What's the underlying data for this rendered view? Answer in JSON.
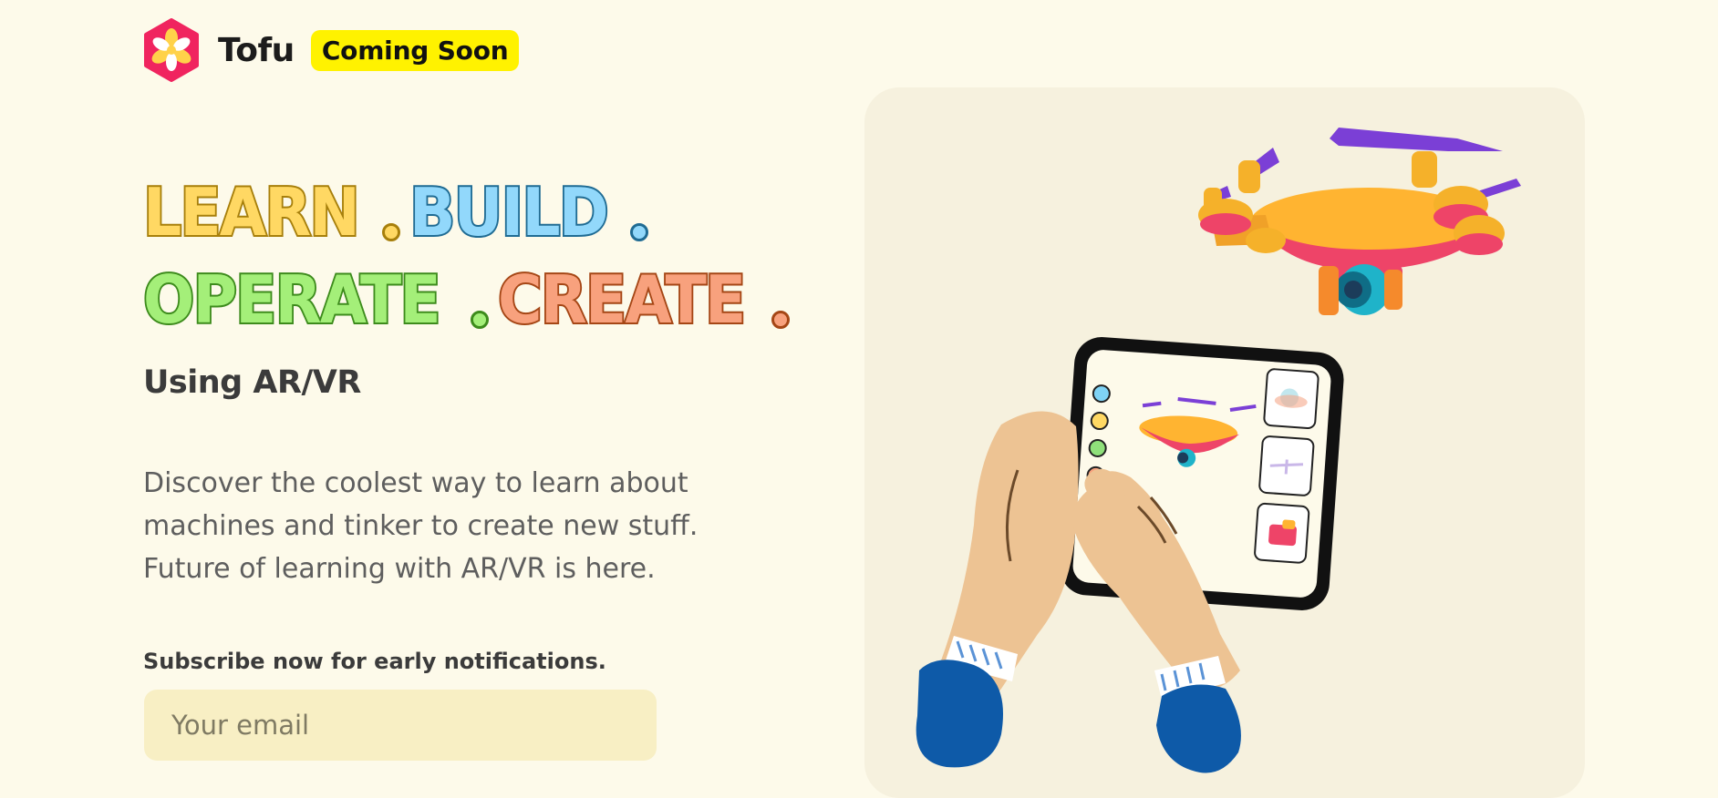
{
  "header": {
    "brand": "Tofu",
    "badge": "Coming Soon",
    "logo_icon": "tofu-flower-hexagon-logo",
    "colors": {
      "logo": "#f0245f",
      "badge_bg": "#fff200"
    }
  },
  "hero": {
    "headline": {
      "line1": [
        {
          "word": "LEARN",
          "color": "#ffd863"
        },
        {
          "word": "BUILD",
          "color": "#92d8fb"
        }
      ],
      "line2": [
        {
          "word": "OPERATE",
          "color": "#a4ef79"
        },
        {
          "word": "CREATE",
          "color": "#f8a17d"
        }
      ]
    },
    "subtitle": "Using AR/VR",
    "description": "Discover the coolest way to learn about machines and tinker to create new stuff. Future of learning with AR/VR is here.",
    "subscribe_label": "Subscribe now for early notifications.",
    "email_placeholder": "Your email"
  },
  "illustration": {
    "name": "hands-holding-tablet-with-drone",
    "icons": [
      "drone-icon",
      "tablet-icon",
      "hand-icon"
    ]
  },
  "theme": {
    "background": "#fdfaea",
    "panel": "#f6f1de",
    "input_bg": "#f8efc4"
  }
}
